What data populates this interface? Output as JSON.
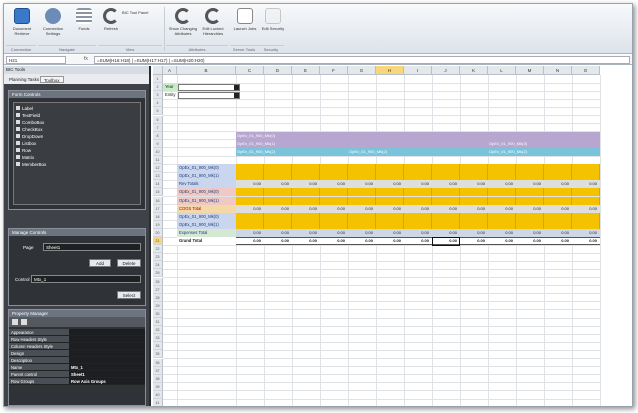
{
  "ribbon": {
    "buttons": [
      {
        "label": "Document Retrieve",
        "icon": "document-icon"
      },
      {
        "label": "Connection Settings",
        "icon": "connection-icon"
      },
      {
        "label": "Funds",
        "icon": "funds-icon"
      },
      {
        "label": "Refresh",
        "icon": "refresh-icon"
      },
      {
        "label": "Show Changing Attributes",
        "icon": "refresh-circle-icon"
      },
      {
        "label": "Edit Locked Hierarchies",
        "icon": "refresh-circle-icon"
      },
      {
        "label": "Launch Jobs",
        "icon": "page-icon"
      },
      {
        "label": "Edit Security",
        "icon": "page-icon"
      }
    ],
    "small_item": "BIC Tool Panel",
    "groups": [
      "Connection",
      "Navigate",
      "View",
      "Attributes",
      "Server Tools",
      "Security"
    ]
  },
  "formula_bar": {
    "name_box": "H21",
    "fx": "fx",
    "formula": "=SUM(H16:H18) | =SUM(H17:H17) | =SUM(H20:H20)"
  },
  "side_panel": {
    "title": "BIC Tools",
    "tabs": [
      "Planning Tasks",
      "Toolbox"
    ],
    "form_controls_title": "Form Controls",
    "form_controls": [
      "Label",
      "TextField",
      "ComboBox",
      "CheckBox",
      "DropDown",
      "Listbox",
      "Row",
      "Matrix",
      "MemberBox"
    ],
    "manage_controls_title": "Manage Controls",
    "page_label": "Page",
    "page_value": "Sheet1",
    "add_label": "Add",
    "delete_label": "Delete",
    "control_label": "Control",
    "control_value": "Mtx_1",
    "select_label": "Select",
    "property_title": "Property Manager",
    "properties": [
      {
        "k": "Appearance",
        "v": ""
      },
      {
        "k": "Row Headers Style",
        "v": ""
      },
      {
        "k": "Column Headers Style",
        "v": ""
      },
      {
        "k": "Design",
        "v": ""
      },
      {
        "k": "Description",
        "v": ""
      },
      {
        "k": "Name",
        "v": "Mtx_1"
      },
      {
        "k": "Parent control",
        "v": "Sheet1"
      },
      {
        "k": "Row Groups",
        "v": "Row Axis Groups"
      }
    ]
  },
  "sheet": {
    "columns": [
      "A",
      "B",
      "C",
      "D",
      "E",
      "F",
      "G",
      "H",
      "I",
      "J",
      "K",
      "L",
      "M",
      "N",
      "O"
    ],
    "year_label": "Year",
    "entity_label": "Entity",
    "headers": [
      "OpEx_01_900_Mk(0)",
      "OpEx_01_900_Mk(1)",
      "OpEx_01_900_Mk(2)",
      "OpEx_01_900_Mk(3)"
    ],
    "rows": [
      {
        "label": "OpEx_01_900_Mk(0)",
        "kind": "data"
      },
      {
        "label": "OpEx_01_900_Mk(1)",
        "kind": "data"
      },
      {
        "label": "Rev Totals",
        "kind": "total"
      },
      {
        "label": "OpEx_01_900_Mk(0)",
        "kind": "data"
      },
      {
        "label": "OpEx_01_900_Mk(1)",
        "kind": "data"
      },
      {
        "label": "COGS Total",
        "kind": "total"
      },
      {
        "label": "OpEx_01_900_Mk(0)",
        "kind": "data"
      },
      {
        "label": "OpEx_01_900_Mk(1)",
        "kind": "data"
      },
      {
        "label": "Expenses Total",
        "kind": "exp"
      },
      {
        "label": "Grand Total",
        "kind": "grand"
      }
    ],
    "zero": "0.00",
    "colors": {
      "purple": "#b7a6cf",
      "cyan": "#6fc9dd",
      "yellow": "#f5c200",
      "label_blue": "#c9d6ee",
      "label_pink": "#f1c9c4",
      "total_gray": "#dedede",
      "expense_blue": "#cdd7e8",
      "selected_col": "#f7e27a"
    }
  }
}
